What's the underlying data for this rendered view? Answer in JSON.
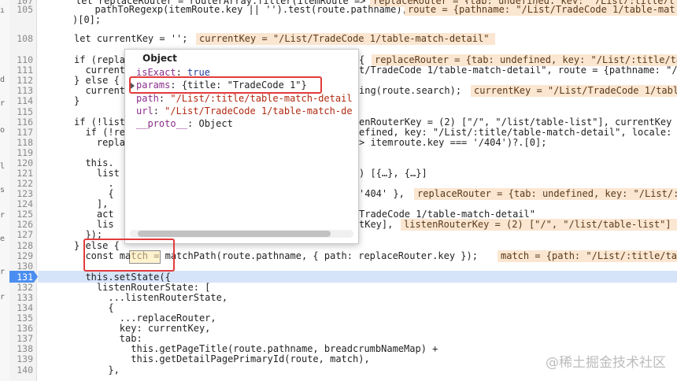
{
  "gutter_left_chars": [
    "ı",
    "d",
    "r",
    "o",
    "l",
    "s",
    "r",
    "e",
    "r",
    "r"
  ],
  "line_numbers": [
    "107",
    "105",
    "",
    "108",
    "",
    "110",
    "111",
    "112",
    "113",
    "114",
    "115",
    "116",
    "117",
    "118",
    "119",
    "120",
    "121",
    "122",
    "123",
    "124",
    "125",
    "126",
    "127",
    "128",
    "129",
    "130",
    "131",
    "132",
    "133",
    "134",
    "135",
    "136",
    "137",
    "138",
    "139",
    "140"
  ],
  "active_line": "131",
  "code": {
    "l107": "let replaceRouter = routerArray.filter(itemRoute =>",
    "l105": "  pathToRegexp(itemRoute.key || '').test(route.pathname),",
    "l106": ")[0];",
    "l108": "let currentKey = '';",
    "l110": "if (repla",
    "l111": "  current",
    "l112": "} else {",
    "l113": "  current",
    "l114": "}",
    "l116": "if (!list",
    "l117": "  if (!re",
    "l118": "    repla",
    "l120": "  this.",
    "l121": "    list",
    "l122": "      .",
    "l123": "      {",
    "l124": "    ],",
    "l125": "    act",
    "l126": "    lis",
    "l127": "  });",
    "l128": "} else {",
    "l129": "  const match = matchPath(route.pathname, { path: replaceRouter.key });",
    "l131": "  this.setState({",
    "l132": "    listenRouterState: [",
    "l133": "      ...listenRouterState,",
    "l134": "      {",
    "l135": "        ...replaceRouter,",
    "l136": "        key: currentKey,",
    "l137": "        tab:",
    "l138": "          this.getPageTitle(route.pathname, breadcrumbNameMap) +",
    "l139": "          this.getDetailPagePrimaryId(route, match),",
    "l140": "      },"
  },
  "code_right": {
    "r110": "{",
    "r111": "t/TradeCode 1/table-match-detail\", route = {pathname: \"/",
    "r113": "ing(route.search);",
    "r116": "enRouterKey = (2) [\"/\", \"/list/table-list\"], currentKey",
    "r117": "efined, key: \"/List/:title/table-match-detail\", locale:",
    "r118": "> itemroute.key === '/404')?.[0];",
    "r121": ") [{…}, {…}]",
    "r123": "'404' },",
    "r125": "TradeCode 1/table-match-detail\"",
    "r126": "tKey],"
  },
  "inline_values": {
    "i107": "replaceRouter = {tab: undefined, key: \"/List/:title/t",
    "i105": "route = {pathname: \"/List/TradeCode 1/table-mat",
    "i108": "currentKey = \"/List/TradeCode 1/table-match-detail\"",
    "i110": "replaceRouter = {tab: undefined, key: \"/List/:title/tab",
    "i113": "currentKey = \"/List/TradeCode 1/tabl",
    "i123": "replaceRouter = {tab: undefined, key: \"/List/:",
    "i126": "listenRouterKey = (2) [\"/\", \"/list/table-list\"]",
    "i129": "match = {path: \"/List/:title/ta"
  },
  "tooltip": {
    "title": "Object",
    "isExact_key": "isExact",
    "isExact_val": "true",
    "params_key": "params",
    "params_val": "{title: \"TradeCode 1\"}",
    "path_key": "path",
    "path_val": "\"/List/:title/table-match-detail",
    "url_key": "url",
    "url_val": "\"/List/TradeCode 1/table-match-de",
    "proto_key": "__proto__",
    "proto_val": "Object"
  },
  "watermark": "@稀土掘金技术社区"
}
